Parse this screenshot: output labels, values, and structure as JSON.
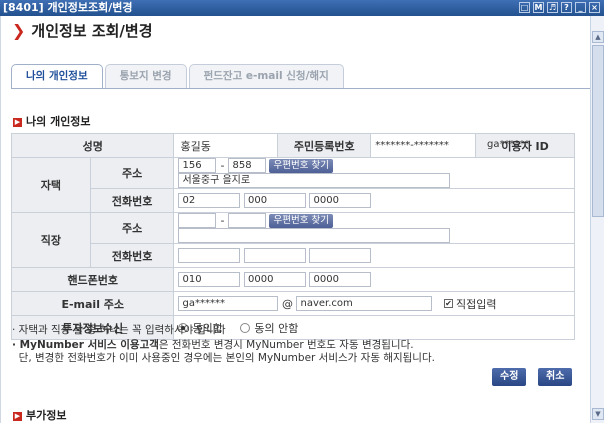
{
  "window": {
    "title": "[8401] 개인정보조회/변경",
    "controls": [
      "□",
      "M",
      "♬",
      "?",
      "_",
      "×"
    ]
  },
  "page": {
    "title": "개인정보 조회/변경"
  },
  "tabs": [
    {
      "label": "나의 개인정보",
      "active": true
    },
    {
      "label": "통보지 변경",
      "active": false
    },
    {
      "label": "펀드잔고 e-mail 신청/해지",
      "active": false
    }
  ],
  "section_title": "나의 개인정보",
  "form": {
    "name_label": "성명",
    "name_value": "홍길동",
    "ssn_label": "주민등록번호",
    "ssn_value": "*******-*******",
    "userid_label": "이용자 ID",
    "userid_value": "ga******",
    "home": {
      "group_label": "자택",
      "address_label": "주소",
      "zip1": "156",
      "zip2": "858",
      "zip_button": "우편번호 찾기",
      "address1": "서울중구 을지로",
      "phone_label": "전화번호",
      "phone1": "02",
      "phone2": "000",
      "phone3": "0000"
    },
    "work": {
      "group_label": "직장",
      "address_label": "주소",
      "zip_button": "우편번호 찾기",
      "phone_label": "전화번호"
    },
    "mobile_label": "핸드폰번호",
    "mobile1": "010",
    "mobile2": "0000",
    "mobile3": "0000",
    "email_label": "E-mail 주소",
    "email_id": "ga******",
    "email_at": "@",
    "email_domain": "naver.com",
    "direct_input": "직접입력",
    "consent_label": "투자정보수신",
    "consent_agree": "동의함",
    "consent_disagree": "동의 안함"
  },
  "notes": {
    "n1": "· 자택과 직장 둘 중 하나는 꼭 입력하셔야 합니다",
    "n2_bold": "· MyNumber 서비스 이용고객",
    "n2_rest": "은 전화번호 변경시 MyNumber 번호도 자동 변경됩니다.",
    "n3": "  단, 변경한 전화번호가 이미 사용중인 경우에는 본인의 MyNumber 서비스가 자동 해지됩니다."
  },
  "buttons": {
    "modify": "수정",
    "cancel": "취소"
  },
  "section2_title": "부가정보"
}
